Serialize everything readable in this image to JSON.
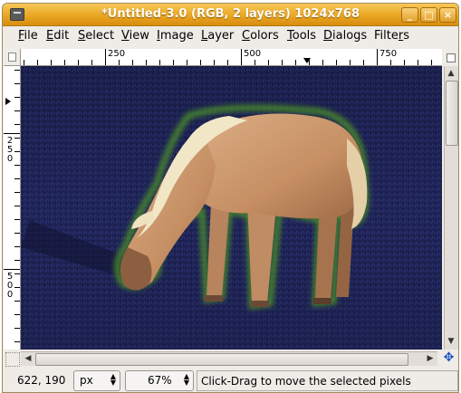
{
  "window": {
    "title": "*Untitled-3.0 (RGB, 2 layers) 1024x768",
    "buttons": {
      "minimize": "_",
      "maximize": "□",
      "close": "×"
    }
  },
  "menubar": {
    "items": [
      {
        "pre": "",
        "ul": "F",
        "post": "ile"
      },
      {
        "pre": "",
        "ul": "E",
        "post": "dit"
      },
      {
        "pre": "",
        "ul": "S",
        "post": "elect"
      },
      {
        "pre": "",
        "ul": "V",
        "post": "iew"
      },
      {
        "pre": "",
        "ul": "I",
        "post": "mage"
      },
      {
        "pre": "",
        "ul": "L",
        "post": "ayer"
      },
      {
        "pre": "",
        "ul": "C",
        "post": "olors"
      },
      {
        "pre": "",
        "ul": "T",
        "post": "ools"
      },
      {
        "pre": "",
        "ul": "D",
        "post": "ialogs"
      },
      {
        "pre": "Filte",
        "ul": "r",
        "post": "s"
      }
    ]
  },
  "rulers": {
    "horizontal_labels": [
      "250",
      "500",
      "750"
    ],
    "vertical_labels": [
      "250",
      "500"
    ]
  },
  "statusbar": {
    "coordinates": "622, 190",
    "unit": "px",
    "zoom": "67%",
    "message": "Click-Drag to move the selected pixels"
  },
  "colors": {
    "titlebar": "#e9a623",
    "canvas_background": "#1c2150",
    "selection_glow": "#4a8a2a",
    "horse_coat": "#c9966e",
    "horse_mane": "#efe2c0"
  },
  "icons": {
    "window_menu": "window-menu-icon",
    "ruler_corner": "quick-mask-icon",
    "navigate": "navigate-icon",
    "scroll_up": "arrow-up-icon",
    "scroll_down": "arrow-down-icon",
    "scroll_left": "arrow-left-icon",
    "scroll_right": "arrow-right-icon"
  }
}
